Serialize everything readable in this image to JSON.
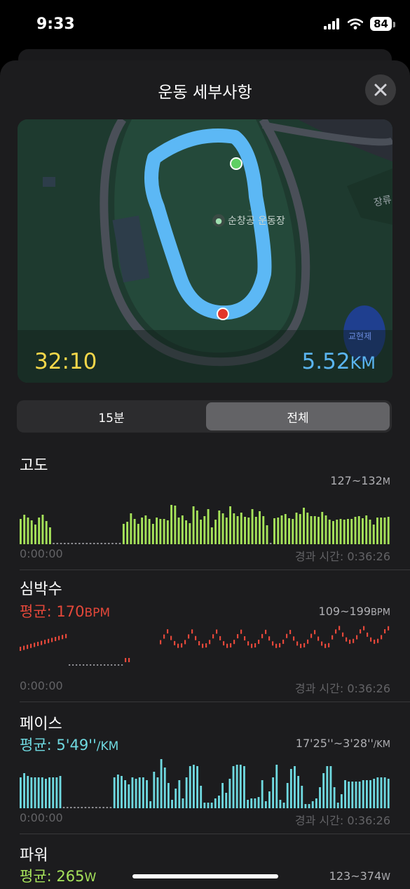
{
  "status_bar": {
    "time": "9:33",
    "battery": "84"
  },
  "sheet": {
    "title": "운동 세부사항"
  },
  "map": {
    "duration": "32:10",
    "distance_value": "5.52",
    "distance_unit": "KM",
    "stadium_label": "순창공 운동장",
    "road_label": "장류",
    "lake_label": "교현제"
  },
  "segments": {
    "left": "15분",
    "right": "전체",
    "selected": "전체"
  },
  "metrics": {
    "altitude": {
      "name": "고도",
      "range": "127~132",
      "range_unit": "M",
      "start": "0:00:00",
      "elapsed": "경과 시간: 0:36:26",
      "color": "#a6e35a",
      "bars": [
        36,
        42,
        38,
        34,
        28,
        38,
        42,
        33,
        24,
        0,
        0,
        0,
        0,
        0,
        0,
        0,
        0,
        0,
        0,
        0,
        0,
        0,
        0,
        0,
        0,
        0,
        0,
        0,
        29,
        32,
        44,
        36,
        29,
        38,
        41,
        36,
        29,
        38,
        36,
        36,
        34,
        56,
        55,
        38,
        41,
        34,
        30,
        54,
        48,
        35,
        40,
        50,
        24,
        35,
        48,
        44,
        38,
        54,
        44,
        40,
        45,
        39,
        38,
        50,
        39,
        47,
        40,
        27,
        0,
        37,
        38,
        41,
        43,
        37,
        36,
        45,
        43,
        52,
        45,
        40,
        40,
        39,
        46,
        41,
        35,
        33,
        35,
        36,
        35,
        36,
        36,
        39,
        40,
        37,
        41,
        35,
        28,
        38,
        38,
        38,
        39
      ]
    },
    "heart_rate": {
      "name": "심박수",
      "avg_label": "평균: ",
      "avg_value": "170",
      "avg_unit": "BPM",
      "range": "109~199",
      "range_unit": "BPM",
      "start": "0:00:00",
      "elapsed": "경과 시간: 0:36:26",
      "color": "#e5483a"
    },
    "pace": {
      "name": "페이스",
      "avg_label": "평균: ",
      "avg_value": "5'49''",
      "avg_unit": "/KM",
      "range": "17'25''~3'28''",
      "range_unit": "/KM",
      "start": "0:00:00",
      "elapsed": "경과 시간: 0:36:26",
      "color": "#6fd9e0",
      "bars": [
        44,
        50,
        46,
        44,
        44,
        44,
        44,
        42,
        44,
        44,
        44,
        46,
        0,
        0,
        0,
        0,
        0,
        0,
        0,
        0,
        0,
        0,
        0,
        0,
        0,
        0,
        44,
        48,
        46,
        40,
        34,
        44,
        42,
        44,
        44,
        40,
        10,
        52,
        44,
        70,
        58,
        36,
        12,
        28,
        40,
        14,
        44,
        60,
        62,
        60,
        32,
        8,
        8,
        8,
        14,
        18,
        36,
        22,
        42,
        60,
        62,
        62,
        60,
        12,
        14,
        14,
        16,
        40,
        10,
        24,
        44,
        62,
        12,
        8,
        36,
        56,
        60,
        46,
        32,
        6,
        6,
        10,
        14,
        30,
        50,
        60,
        60,
        30,
        8,
        20,
        40,
        38,
        38,
        38,
        38,
        40,
        40,
        40,
        42,
        44,
        44,
        44,
        42
      ]
    },
    "power": {
      "name": "파워",
      "avg_label": "평균: ",
      "avg_value": "265",
      "avg_unit": "W",
      "range": "123~374",
      "range_unit": "W",
      "color": "#a6e35a"
    }
  }
}
